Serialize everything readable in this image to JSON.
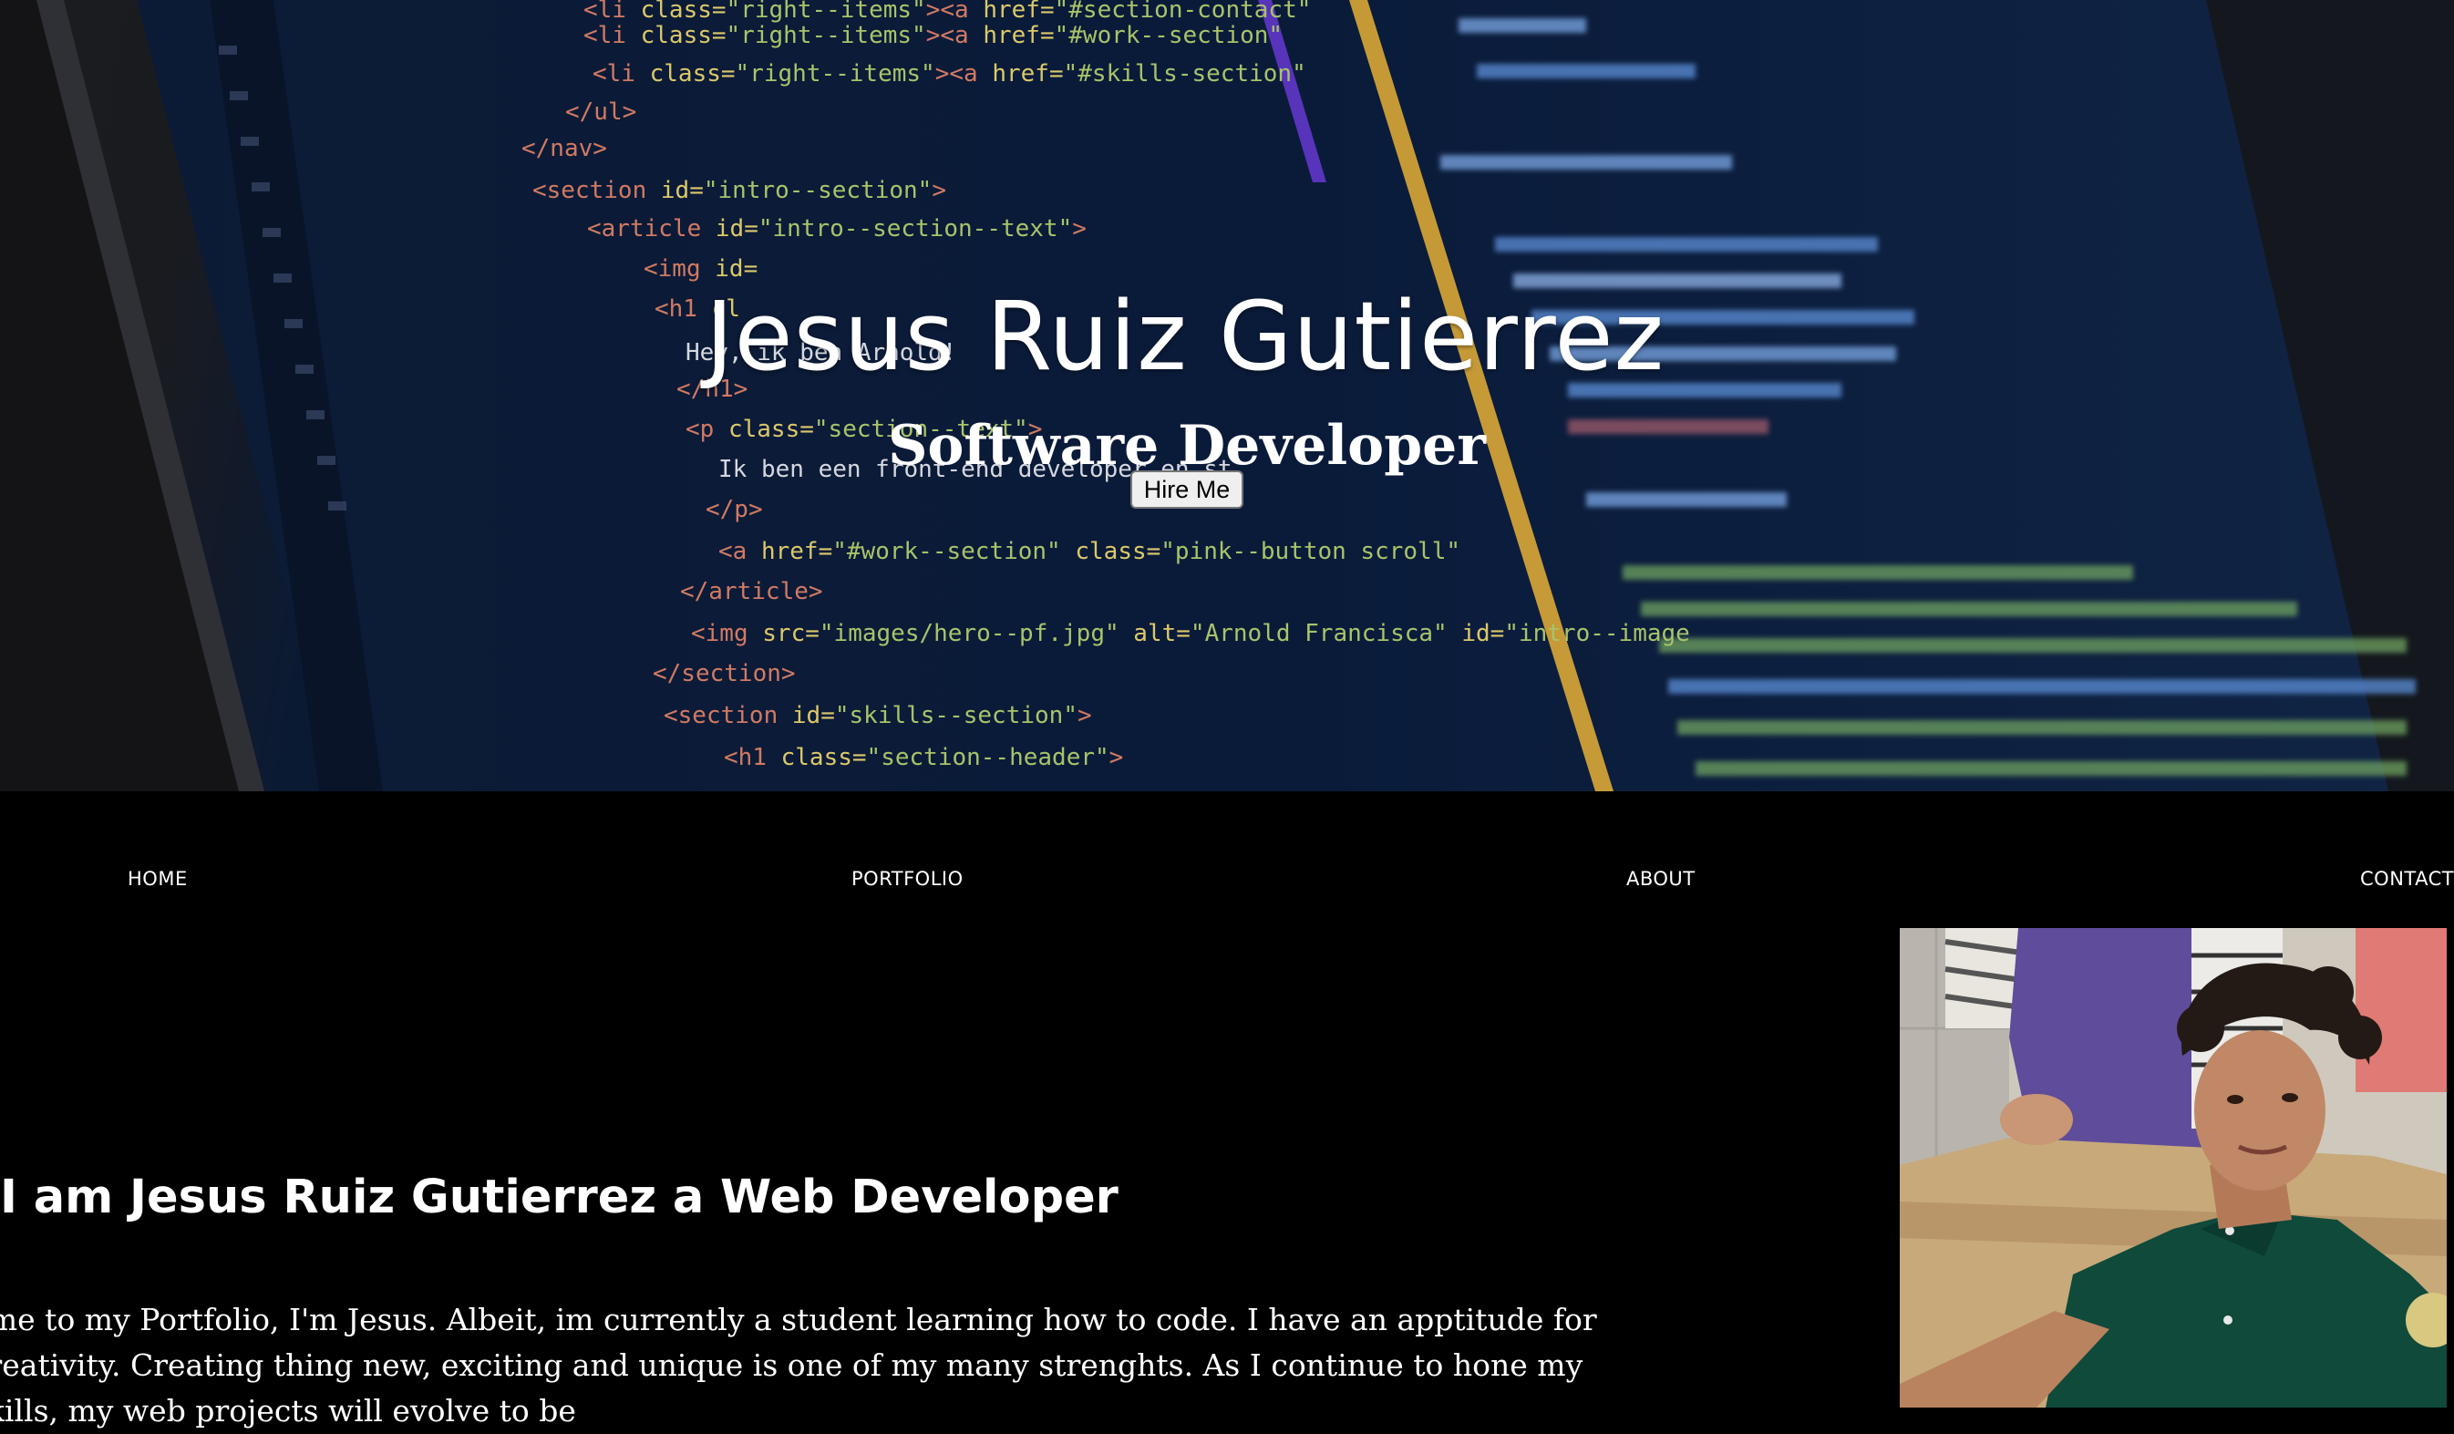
{
  "hero": {
    "title": "Jesus Ruiz Gutierrez",
    "subtitle": "Software Developer",
    "cta_label": "Hire Me"
  },
  "nav": {
    "items": [
      {
        "label": "HOME"
      },
      {
        "label": "PORTFOLIO"
      },
      {
        "label": "ABOUT"
      },
      {
        "label": "CONTACT"
      }
    ]
  },
  "about": {
    "heading": "I am Jesus Ruiz Gutierrez a Web Developer",
    "paragraph": "ome to my Portfolio, I'm Jesus. Albeit, im currently a student learning how to code. I have an apptitude for creativity. Creating thing new, exciting and unique is one of my many strenghts. As I continue to hone my skills, my web projects will evolve to be"
  },
  "colors": {
    "page_background": "#000000",
    "text": "#ffffff",
    "hero_background": "#0a1a36"
  }
}
